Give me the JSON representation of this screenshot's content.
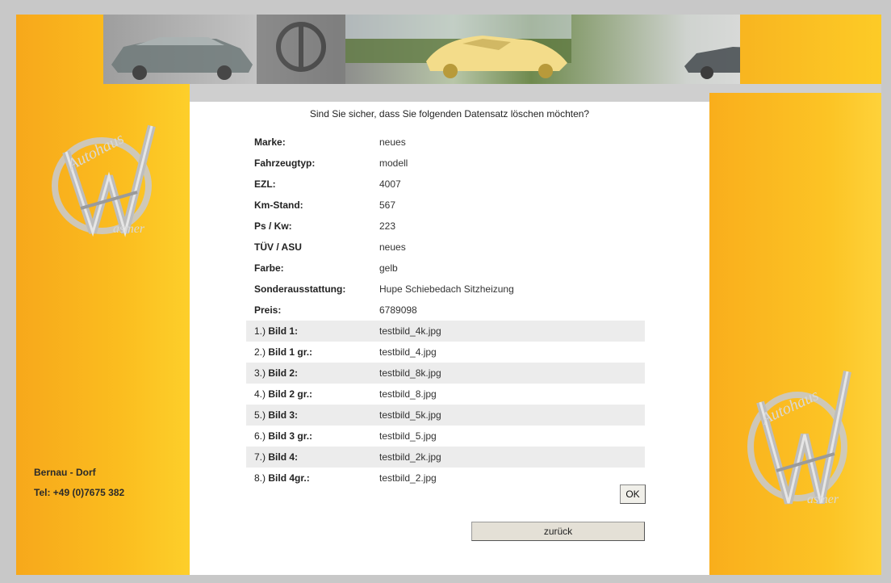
{
  "banner": {
    "name": "car-banner"
  },
  "logo": {
    "brand_text": "Autohaus",
    "sub_text": "asmer"
  },
  "contact": {
    "location": "Bernau - Dorf",
    "phone": "Tel: +49 (0)7675 382"
  },
  "dialog": {
    "question": "Sind Sie sicher, dass Sie folgenden Datensatz löschen möchten?",
    "fields": [
      {
        "label": "Marke:",
        "value": "neues"
      },
      {
        "label": "Fahrzeugtyp:",
        "value": "modell"
      },
      {
        "label": "EZL:",
        "value": "4007"
      },
      {
        "label": "Km-Stand:",
        "value": "567"
      },
      {
        "label": "Ps / Kw:",
        "value": "223"
      },
      {
        "label": "TÜV / ASU",
        "value": "neues"
      },
      {
        "label": "Farbe:",
        "value": "gelb"
      },
      {
        "label": "Sonderausstattung:",
        "value": "Hupe Schiebedach Sitzheizung"
      },
      {
        "label": "Preis:",
        "value": "6789098"
      }
    ],
    "images": [
      {
        "num": "1.)",
        "label": "Bild 1:",
        "value": "testbild_4k.jpg"
      },
      {
        "num": "2.)",
        "label": "Bild 1 gr.:",
        "value": "testbild_4.jpg"
      },
      {
        "num": "3.)",
        "label": "Bild 2:",
        "value": "testbild_8k.jpg"
      },
      {
        "num": "4.)",
        "label": "Bild 2 gr.:",
        "value": "testbild_8.jpg"
      },
      {
        "num": "5.)",
        "label": "Bild 3:",
        "value": "testbild_5k.jpg"
      },
      {
        "num": "6.)",
        "label": "Bild 3 gr.:",
        "value": "testbild_5.jpg"
      },
      {
        "num": "7.)",
        "label": "Bild 4:",
        "value": "testbild_2k.jpg"
      },
      {
        "num": "8.)",
        "label": "Bild 4gr.:",
        "value": "testbild_2.jpg"
      }
    ],
    "ok_label": "OK",
    "back_label": "zurück"
  },
  "colors": {
    "accent_yellow": "#fbbd1f",
    "frame_gray": "#cfcfcf",
    "row_shade": "#ececec"
  }
}
